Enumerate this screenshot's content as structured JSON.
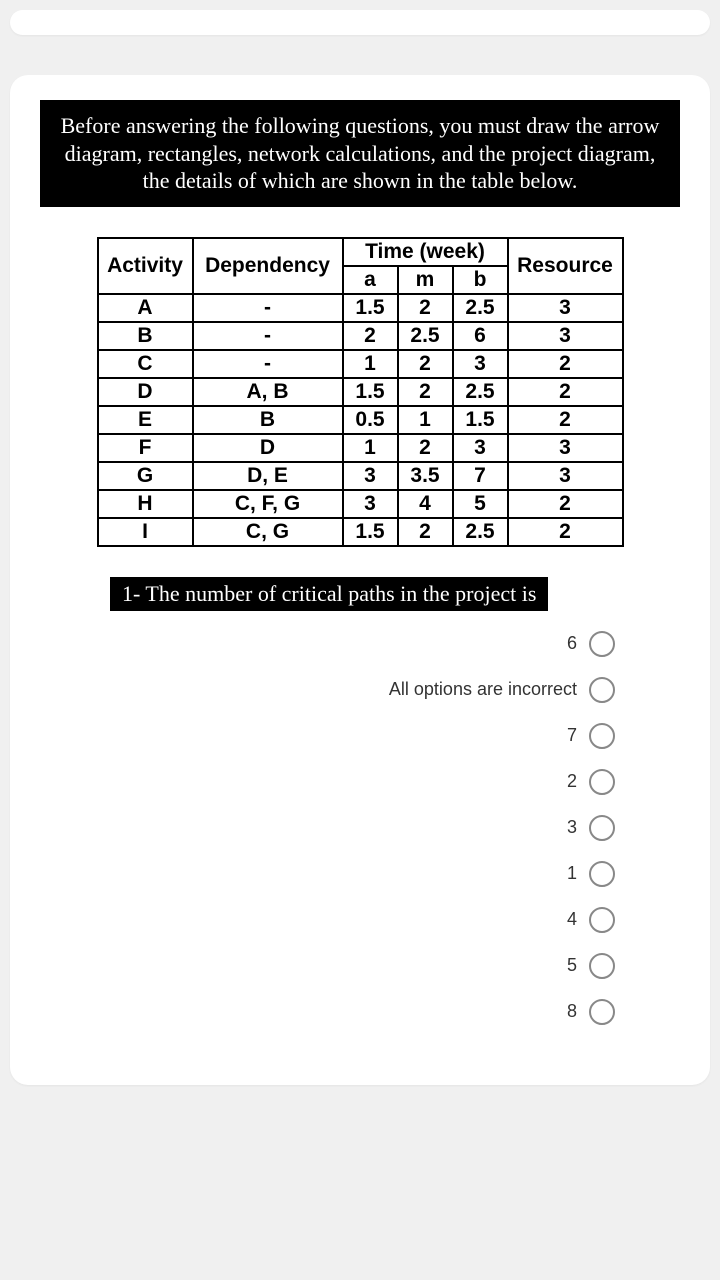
{
  "instruction": "Before answering the following questions, you must draw the arrow diagram, rectangles, network calculations, and the project diagram, the details of which are shown in the table below.",
  "table": {
    "headers": {
      "activity": "Activity",
      "dependency": "Dependency",
      "time_group": "Time (week)",
      "a": "a",
      "m": "m",
      "b": "b",
      "resource": "Resource"
    },
    "rows": [
      {
        "activity": "A",
        "dependency": "-",
        "a": "1.5",
        "m": "2",
        "b": "2.5",
        "resource": "3"
      },
      {
        "activity": "B",
        "dependency": "-",
        "a": "2",
        "m": "2.5",
        "b": "6",
        "resource": "3"
      },
      {
        "activity": "C",
        "dependency": "-",
        "a": "1",
        "m": "2",
        "b": "3",
        "resource": "2"
      },
      {
        "activity": "D",
        "dependency": "A, B",
        "a": "1.5",
        "m": "2",
        "b": "2.5",
        "resource": "2"
      },
      {
        "activity": "E",
        "dependency": "B",
        "a": "0.5",
        "m": "1",
        "b": "1.5",
        "resource": "2"
      },
      {
        "activity": "F",
        "dependency": "D",
        "a": "1",
        "m": "2",
        "b": "3",
        "resource": "3"
      },
      {
        "activity": "G",
        "dependency": "D, E",
        "a": "3",
        "m": "3.5",
        "b": "7",
        "resource": "3"
      },
      {
        "activity": "H",
        "dependency": "C, F, G",
        "a": "3",
        "m": "4",
        "b": "5",
        "resource": "2"
      },
      {
        "activity": "I",
        "dependency": "C, G",
        "a": "1.5",
        "m": "2",
        "b": "2.5",
        "resource": "2"
      }
    ]
  },
  "question": {
    "text": "1- The number of critical paths in the project is",
    "options": [
      {
        "label": "6"
      },
      {
        "label": "All options are incorrect"
      },
      {
        "label": "7"
      },
      {
        "label": "2"
      },
      {
        "label": "3"
      },
      {
        "label": "1"
      },
      {
        "label": "4"
      },
      {
        "label": "5"
      },
      {
        "label": "8"
      }
    ]
  }
}
